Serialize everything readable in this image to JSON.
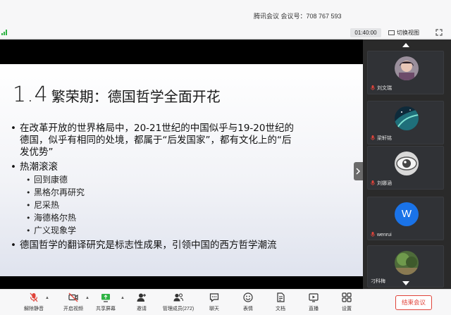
{
  "window": {
    "title": "腾讯会议 会议号：708 767 593",
    "timer": "01:40:00",
    "switch_view": "切换视图"
  },
  "slide": {
    "number": "1.4",
    "title": "繁荣期：德国哲学全面开花",
    "bullets": [
      {
        "line1": "在改革开放的世界格局中，20-21世纪的中国似乎与19-20世纪的",
        "line2": "德国，似乎有相同的处境，都属于“后发国家”，都有文化上的“后",
        "line3": "发优势”"
      },
      {
        "line1": "热潮滚滚"
      },
      {
        "line1": "德国哲学的翻译研究是标志性成果，引领中国的西方哲学潮流"
      }
    ],
    "subitems": [
      "回到康德",
      "黑格尔再研究",
      "尼采热",
      "海德格尔热",
      "广义现象学"
    ],
    "bullet_char": "•",
    "sub_char": "•"
  },
  "participants": [
    {
      "name": "刘文瑞",
      "avatar": "photo"
    },
    {
      "name": "梁轩铭",
      "avatar": "aurora"
    },
    {
      "name": "刘娜涵",
      "avatar": "eye"
    },
    {
      "name": "wenrui",
      "avatar": "letter",
      "letter": "W",
      "color": "#1a73e8"
    },
    {
      "name": "刁科梅",
      "avatar": "landscape"
    }
  ],
  "toolbar": {
    "mute": "解除静音",
    "video": "开启视频",
    "share": "共享屏幕",
    "invite": "邀请",
    "members": "管理成员(272)",
    "chat": "聊天",
    "reactions": "表情",
    "docs": "文档",
    "live": "直播",
    "settings": "设置",
    "end": "结束会议"
  },
  "colors": {
    "end_red": "#e0433a",
    "signal_green": "#2fb344",
    "mic_muted": "#e0433a"
  }
}
